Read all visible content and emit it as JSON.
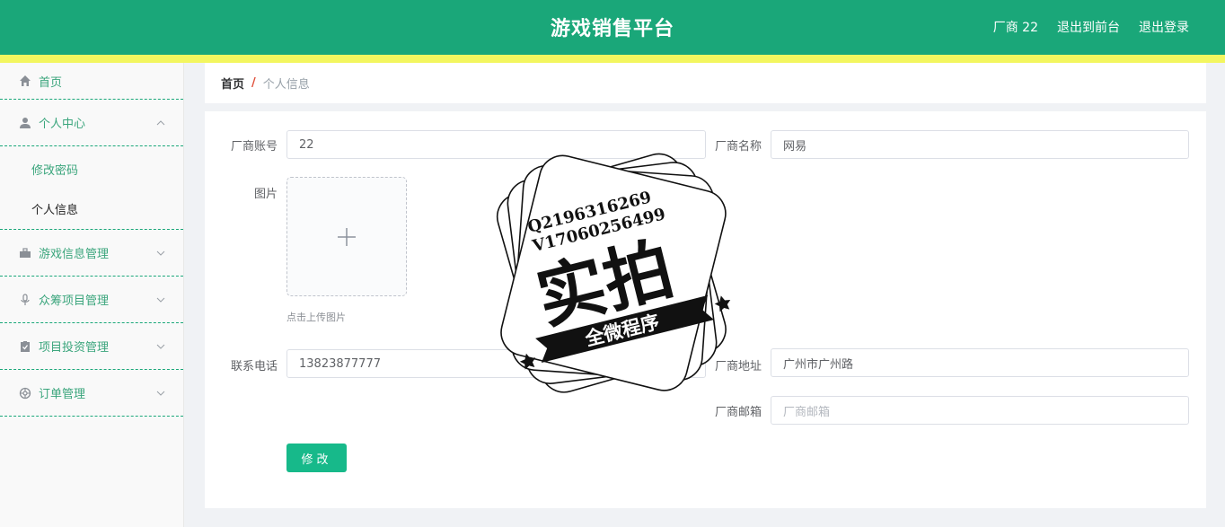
{
  "header": {
    "title": "游戏销售平台",
    "user": "厂商 22",
    "to_front": "退出到前台",
    "logout": "退出登录",
    "bg_color": "#1aa779",
    "strip_color": "#f3f65f"
  },
  "sidebar": {
    "home": "首页",
    "personal_center": "个人中心",
    "change_password": "修改密码",
    "personal_info": "个人信息",
    "game_info": "游戏信息管理",
    "crowdfunding": "众筹项目管理",
    "investment": "项目投资管理",
    "orders": "订单管理"
  },
  "breadcrumb": {
    "home": "首页",
    "separator": "/",
    "current": "个人信息"
  },
  "form": {
    "account_label": "厂商账号",
    "account_value": "22",
    "name_label": "厂商名称",
    "name_value": "网易",
    "image_label": "图片",
    "upload_tip": "点击上传图片",
    "phone_label": "联系电话",
    "phone_value": "13823877777",
    "address_label": "厂商地址",
    "address_value": "广州市广州路",
    "email_label": "厂商邮箱",
    "email_placeholder": "厂商邮箱",
    "submit_label": "修改",
    "accent_color": "#17b98a"
  },
  "watermark": {
    "line1": "Q2196316269",
    "line2": "V17060256499",
    "main": "实拍",
    "banner": "全微程序"
  }
}
